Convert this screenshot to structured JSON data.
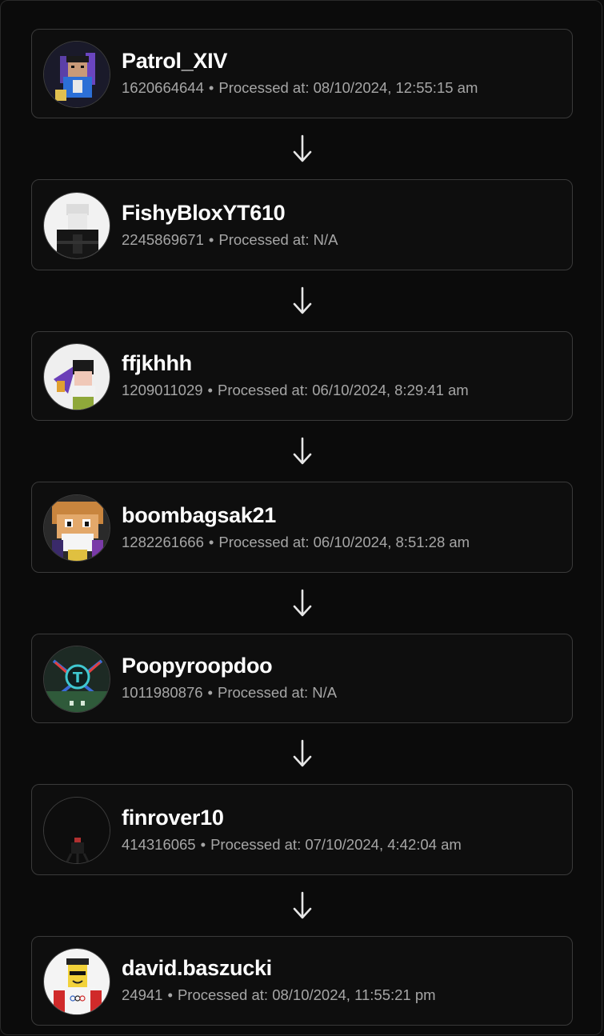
{
  "separator": "•",
  "users": [
    {
      "name": "Patrol_XIV",
      "id": "1620664644",
      "processed_label": "Processed at:",
      "processed": "08/10/2024, 12:55:15 am",
      "avatar_icon": "avatar-patrol-icon"
    },
    {
      "name": "FishyBloxYT610",
      "id": "2245869671",
      "processed_label": "Processed at:",
      "processed": "N/A",
      "avatar_icon": "avatar-fishy-icon"
    },
    {
      "name": "ffjkhhh",
      "id": "1209011029",
      "processed_label": "Processed at:",
      "processed": "06/10/2024, 8:29:41 am",
      "avatar_icon": "avatar-ffjkhhh-icon"
    },
    {
      "name": "boombagsak21",
      "id": "1282261666",
      "processed_label": "Processed at:",
      "processed": "06/10/2024, 8:51:28 am",
      "avatar_icon": "avatar-boombag-icon"
    },
    {
      "name": "Poopyroopdoo",
      "id": "1011980876",
      "processed_label": "Processed at:",
      "processed": "N/A",
      "avatar_icon": "avatar-poopy-icon"
    },
    {
      "name": "finrover10",
      "id": "414316065",
      "processed_label": "Processed at:",
      "processed": "07/10/2024, 4:42:04 am",
      "avatar_icon": "avatar-finrover-icon"
    },
    {
      "name": "david.baszucki",
      "id": "24941",
      "processed_label": "Processed at:",
      "processed": "08/10/2024, 11:55:21 pm",
      "avatar_icon": "avatar-david-icon"
    }
  ],
  "colors": {
    "background": "#0b0b0b",
    "card_border": "#3a3a3a",
    "name_text": "#ffffff",
    "meta_text": "#a6a6a6",
    "arrow": "#e6e6e6"
  },
  "connector_icon": "arrow-down-icon"
}
